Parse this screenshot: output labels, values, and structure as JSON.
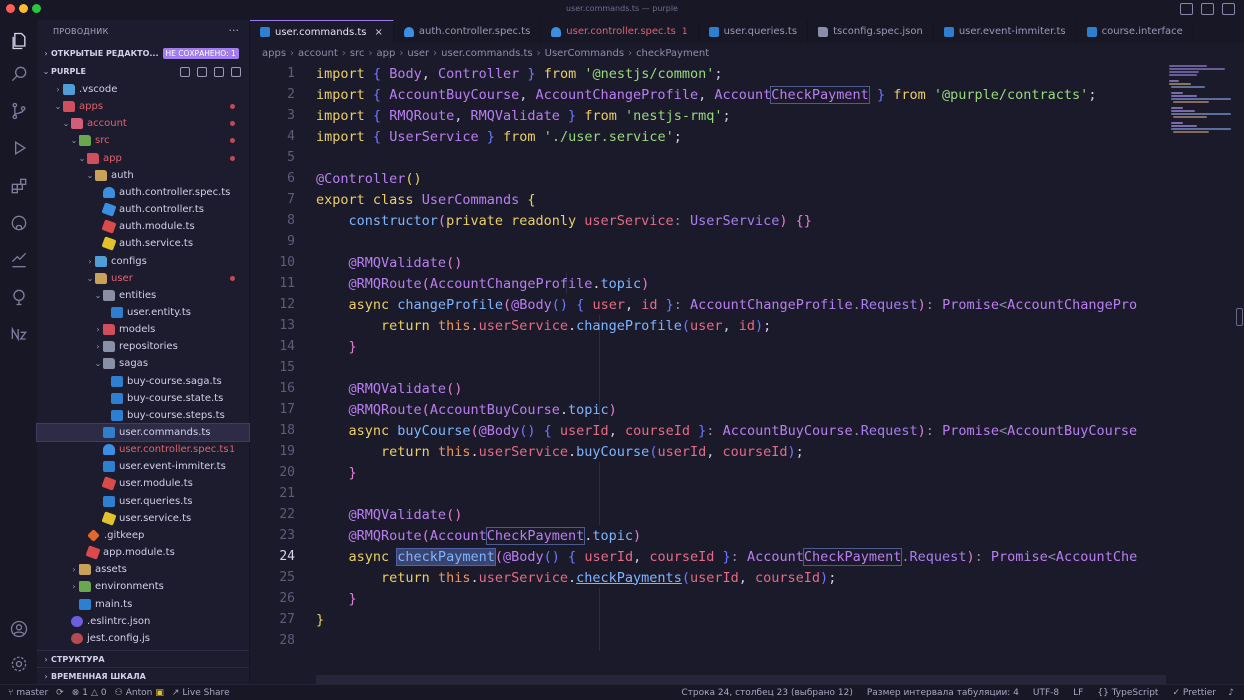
{
  "window": {
    "title": "user.commands.ts — purple",
    "traffic_colors": [
      "#ff5f57",
      "#febc2e",
      "#28c840"
    ]
  },
  "sidebar": {
    "header": "ПРОВОДНИК",
    "more": "···",
    "open_editors_label": "ОТКРЫТЫЕ РЕДАКТО...",
    "unsaved_badge": "НЕ СОХРАНЕНО: 1",
    "root_label": "PURPLE",
    "tree": [
      {
        "label": ".vscode",
        "icon": "folder-blue",
        "depth": 1,
        "chevron": "right"
      },
      {
        "label": "apps",
        "icon": "folder-red",
        "depth": 1,
        "chevron": "down",
        "status": "error-dot"
      },
      {
        "label": "account",
        "icon": "folder-pink",
        "depth": 2,
        "chevron": "down",
        "status": "error-dot"
      },
      {
        "label": "src",
        "icon": "folder-green",
        "depth": 3,
        "chevron": "down",
        "status": "error-dot"
      },
      {
        "label": "app",
        "icon": "folder-red",
        "depth": 4,
        "chevron": "down",
        "status": "error-dot"
      },
      {
        "label": "auth",
        "icon": "folder",
        "depth": 5,
        "chevron": "down"
      },
      {
        "label": "auth.controller.spec.ts",
        "icon": "test",
        "depth": 6
      },
      {
        "label": "auth.controller.ts",
        "icon": "ctrl",
        "depth": 6
      },
      {
        "label": "auth.module.ts",
        "icon": "module",
        "depth": 6
      },
      {
        "label": "auth.service.ts",
        "icon": "service",
        "depth": 6
      },
      {
        "label": "configs",
        "icon": "folder-blue",
        "depth": 5,
        "chevron": "right"
      },
      {
        "label": "user",
        "icon": "folder",
        "depth": 5,
        "chevron": "down",
        "status": "error-dot"
      },
      {
        "label": "entities",
        "icon": "folder-gray",
        "depth": 6,
        "chevron": "down"
      },
      {
        "label": "user.entity.ts",
        "icon": "ts",
        "depth": 7
      },
      {
        "label": "models",
        "icon": "folder-red",
        "depth": 6,
        "chevron": "right"
      },
      {
        "label": "repositories",
        "icon": "folder-gray",
        "depth": 6,
        "chevron": "right"
      },
      {
        "label": "sagas",
        "icon": "folder-gray",
        "depth": 6,
        "chevron": "down"
      },
      {
        "label": "buy-course.saga.ts",
        "icon": "ts",
        "depth": 7
      },
      {
        "label": "buy-course.state.ts",
        "icon": "ts",
        "depth": 7
      },
      {
        "label": "buy-course.steps.ts",
        "icon": "ts",
        "depth": 7
      },
      {
        "label": "user.commands.ts",
        "icon": "ts",
        "depth": 6,
        "selected": true
      },
      {
        "label": "user.controller.spec.ts",
        "icon": "test",
        "depth": 6,
        "status": "error-count",
        "count": "1"
      },
      {
        "label": "user.event-immiter.ts",
        "icon": "ts",
        "depth": 6
      },
      {
        "label": "user.module.ts",
        "icon": "module",
        "depth": 6
      },
      {
        "label": "user.queries.ts",
        "icon": "ts",
        "depth": 6
      },
      {
        "label": "user.service.ts",
        "icon": "service",
        "depth": 6
      },
      {
        "label": ".gitkeep",
        "icon": "git",
        "depth": 4
      },
      {
        "label": "app.module.ts",
        "icon": "module",
        "depth": 4
      },
      {
        "label": "assets",
        "icon": "folder",
        "depth": 3,
        "chevron": "right"
      },
      {
        "label": "environments",
        "icon": "folder-green",
        "depth": 3,
        "chevron": "right"
      },
      {
        "label": "main.ts",
        "icon": "ts",
        "depth": 3
      },
      {
        "label": ".eslintrc.json",
        "icon": "eslint",
        "depth": 2
      },
      {
        "label": "jest.config.js",
        "icon": "jest",
        "depth": 2
      }
    ],
    "outline_label": "СТРУКТУРА",
    "timeline_label": "ВРЕМЕННАЯ ШКАЛА"
  },
  "tabs": [
    {
      "label": "user.commands.ts",
      "icon": "ts",
      "active": true,
      "close": "×"
    },
    {
      "label": "auth.controller.spec.ts",
      "icon": "test"
    },
    {
      "label": "user.controller.spec.ts",
      "icon": "test",
      "error": true,
      "mod": "1"
    },
    {
      "label": "user.queries.ts",
      "icon": "ts"
    },
    {
      "label": "tsconfig.spec.json",
      "icon": "gray"
    },
    {
      "label": "user.event-immiter.ts",
      "icon": "ts"
    },
    {
      "label": "course.interface",
      "icon": "ts"
    }
  ],
  "breadcrumb": [
    "apps",
    "account",
    "src",
    "app",
    "user",
    "user.commands.ts",
    "UserCommands",
    "checkPayment"
  ],
  "editor": {
    "line_numbers": [
      "1",
      "2",
      "3",
      "4",
      "5",
      "6",
      "7",
      "8",
      "9",
      "10",
      "11",
      "12",
      "13",
      "14",
      "15",
      "16",
      "17",
      "18",
      "19",
      "20",
      "21",
      "22",
      "23",
      "24",
      "25",
      "26",
      "27",
      "28"
    ],
    "current_line": "24"
  },
  "status": {
    "branch": "master",
    "sync": "⟳",
    "errors": "1",
    "warnings": "0",
    "user": "Anton",
    "live_share": "Live Share",
    "position": "Строка 24, столбец 23 (выбрано 12)",
    "tab_size": "Размер интервала табуляции: 4",
    "encoding": "UTF-8",
    "eol": "LF",
    "language": "TypeScript",
    "formatter": "Prettier"
  }
}
